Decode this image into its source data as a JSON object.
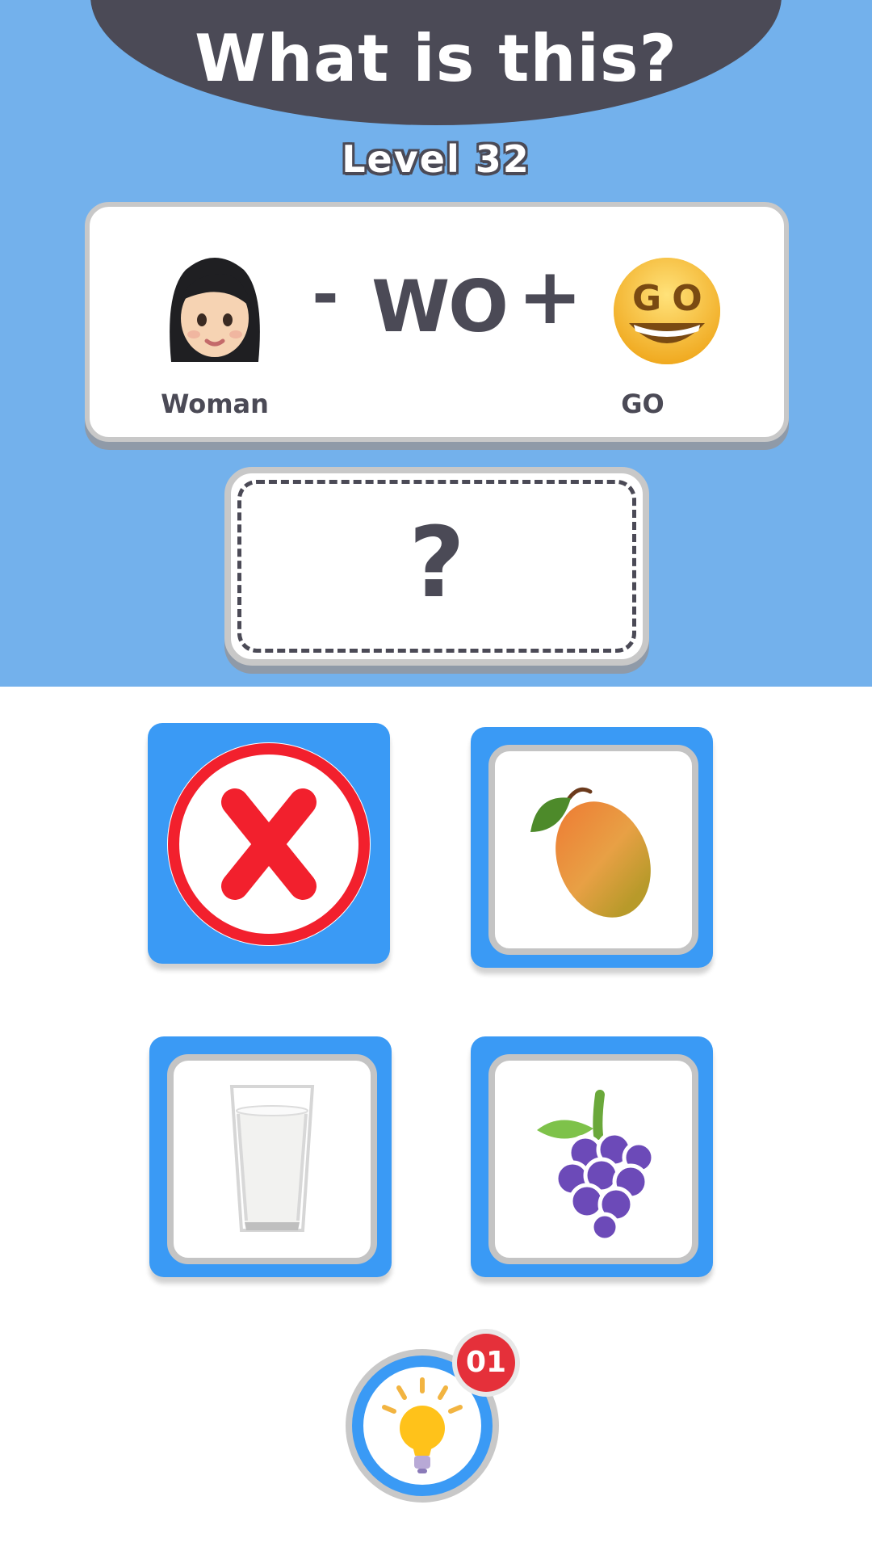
{
  "header": {
    "title": "What is this?",
    "level": "Level 32"
  },
  "puzzle": {
    "left_item_label": "Woman",
    "minus": "-",
    "letters": "WO",
    "plus": "+",
    "right_item_label": "GO"
  },
  "answer": {
    "placeholder": "?"
  },
  "options": [
    {
      "icon": "remove-icon"
    },
    {
      "icon": "mango-icon"
    },
    {
      "icon": "milk-glass-icon"
    },
    {
      "icon": "grapes-icon"
    }
  ],
  "hint": {
    "icon": "lightbulb-icon",
    "count": "01"
  },
  "colors": {
    "sky_background": "#73b1ec",
    "banner": "#4b4a56",
    "tile_blue": "#3a9af5",
    "badge_red": "#e5303a"
  }
}
